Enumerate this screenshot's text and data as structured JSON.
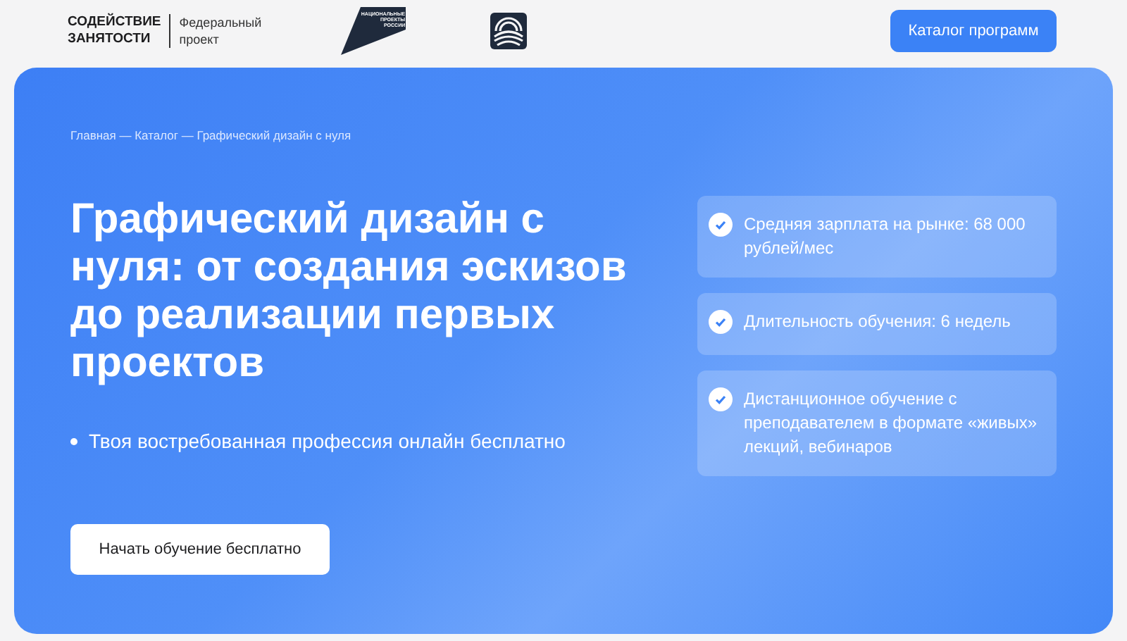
{
  "header": {
    "logo_title": [
      "СОДЕЙСТВИЕ",
      "ЗАНЯТОСТИ"
    ],
    "logo_subtitle": [
      "Федеральный",
      "проект"
    ],
    "national_logo_text": [
      "НАЦИОНАЛЬНЫЕ",
      "ПРОЕКТЫ",
      "РОССИИ"
    ],
    "catalog_button": "Каталог программ"
  },
  "hero": {
    "breadcrumbs": [
      "Главная",
      "Каталог",
      "Графический дизайн с нуля"
    ],
    "breadcrumb_separator": "—",
    "title": "Графический дизайн с нуля: от создания эскизов до реализации первых проектов",
    "bullets": [
      "Твоя востребованная профессия онлайн бесплатно"
    ],
    "start_button": "Начать обучение бесплатно",
    "features": [
      {
        "text": "Средняя зарплата на рынке: 68 000 рублей/мес"
      },
      {
        "text": "Длительность обучения: 6 недель"
      },
      {
        "text": "Дистанционное обучение с преподавателем в формате «живых» лекций, вебинаров"
      }
    ]
  }
}
